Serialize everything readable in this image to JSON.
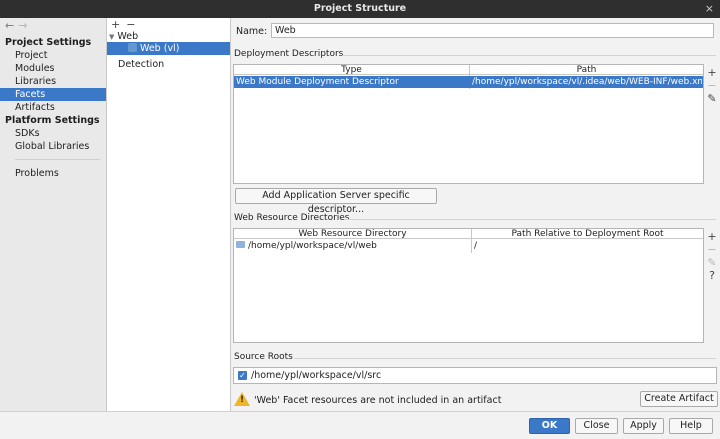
{
  "window": {
    "title": "Project Structure",
    "close_glyph": "×"
  },
  "nav": {
    "back_glyph": "←",
    "forward_glyph": "→",
    "project_settings_header": "Project Settings",
    "project_items": [
      "Project",
      "Modules",
      "Libraries",
      "Facets",
      "Artifacts"
    ],
    "selected_item": "Facets",
    "platform_settings_header": "Platform Settings",
    "platform_items": [
      "SDKs",
      "Global Libraries"
    ],
    "problems": "Problems"
  },
  "facet_tree": {
    "add_glyph": "+",
    "remove_glyph": "−",
    "root": "Web",
    "child": "Web (vl)",
    "detection": "Detection"
  },
  "form": {
    "name_label": "Name:",
    "name_value": "Web",
    "deployment_descriptors_title": "Deployment Descriptors",
    "dd_columns": [
      "Type",
      "Path"
    ],
    "dd_rows": [
      {
        "type": "Web Module Deployment Descriptor",
        "path": "/home/ypl/workspace/vl/.idea/web/WEB-INF/web.xml"
      }
    ],
    "add_server_descriptor_button": "Add Application Server specific descriptor...",
    "web_resource_directories_title": "Web Resource Directories",
    "wr_columns": [
      "Web Resource Directory",
      "Path Relative to Deployment Root"
    ],
    "wr_rows": [
      {
        "directory": "/home/ypl/workspace/vl/web",
        "relative": "/"
      }
    ],
    "source_roots_title": "Source Roots",
    "source_root": "/home/ypl/workspace/vl/src",
    "warning_text": "'Web' Facet resources are not included in an artifact",
    "create_artifact_button": "Create Artifact"
  },
  "tools": {
    "add": "+",
    "remove": "−",
    "edit": "✎",
    "help": "?"
  },
  "footer": {
    "ok": "OK",
    "close": "Close",
    "apply": "Apply",
    "help": "Help"
  },
  "colors": {
    "selection": "#3b78c8",
    "titlebar": "#2f2f2f",
    "warning": "#f0b429"
  }
}
